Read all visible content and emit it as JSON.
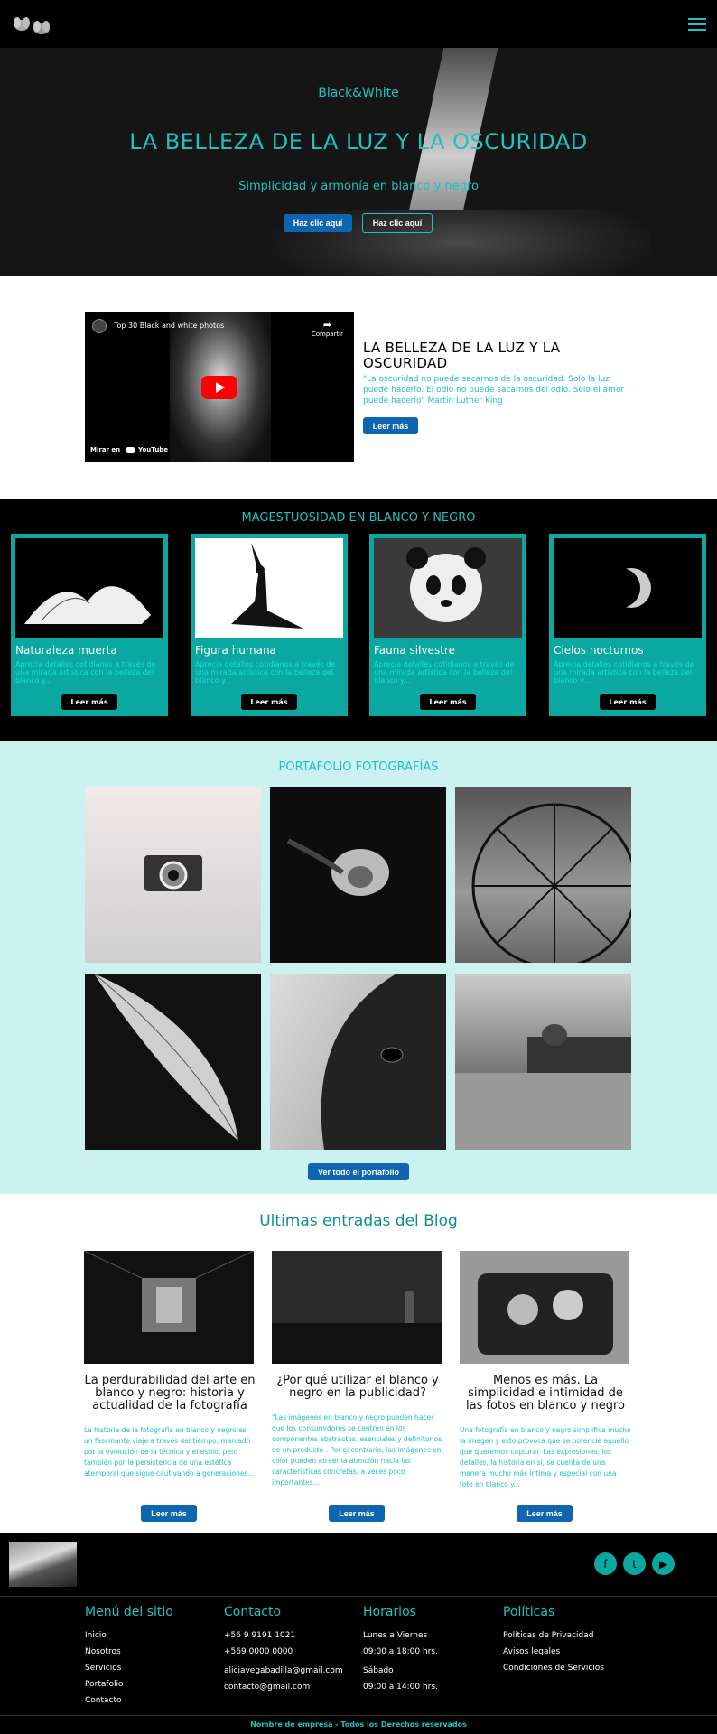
{
  "hero": {
    "brand": "Black&White",
    "title": "LA BELLEZA DE LA LUZ Y LA OSCURIDAD",
    "subtitle": "Simplicidad y armonía en blanco y negro",
    "btn_primary": "Haz clic aquí",
    "btn_secondary": "Haz clic aquí"
  },
  "video": {
    "title": "Top 30 Black and white photos",
    "share": "Compartir",
    "watch_on": "Mirar en",
    "platform": "YouTube"
  },
  "intro": {
    "title": "LA BELLEZA DE LA LUZ Y LA OSCURIDAD",
    "quote": "\"La oscuridad no puede sacarnos de la oscuridad. Solo la luz puede hacerlo. El odio no puede sacarnos del odio. Solo el amor puede hacerlo\" Martin Luther King",
    "button": "Leer más"
  },
  "categories": {
    "title": "MAGESTUOSIDAD EN BLANCO Y NEGRO",
    "items": [
      {
        "title": "Naturaleza muerta",
        "desc": "Aprecia detalles cotidianos a través de una mirada artística con la belleza del blanco y...",
        "button": "Leer más"
      },
      {
        "title": "Figura humana",
        "desc": "Aprecia detalles cotidianos a través de una mirada artística con la belleza del blanco y...",
        "button": "Leer más"
      },
      {
        "title": "Fauna silvestre",
        "desc": "Aprecia detalles cotidianos a través de una mirada artística con la belleza del blanco y...",
        "button": "Leer más"
      },
      {
        "title": "Cielos nocturnos",
        "desc": "Aprecia detalles cotidianos a través de una mirada artística con la belleza del blanco y...",
        "button": "Leer más"
      }
    ]
  },
  "portfolio": {
    "title": "PORTAFOLIO FOTOGRAFÍAS",
    "button": "Ver todo el portafolio"
  },
  "blog": {
    "title": "Ultimas entradas del Blog",
    "posts": [
      {
        "title": "La perdurabilidad del arte en blanco y negro: historia y actualidad de la fotografía",
        "excerpt": "La historia de la fotografía en blanco y negro es un fascinante viaje a través del tiempo, marcado por la evolución de la técnica y el estilo, pero también por la persistencia de una estética atemporal que sigue cautivando a generaciones...",
        "button": "Leer más"
      },
      {
        "title": "¿Por qué utilizar el blanco y negro en la publicidad?",
        "excerpt": "\"Las imágenes en blanco y negro pueden hacer que los consumidores se centren en los componentes abstractos, esenciales y definitorios de un producto . Por el contrario, las imágenes en color pueden atraer la atención hacia las características concretas, a veces poco importantes...",
        "button": "Leer más"
      },
      {
        "title": "Menos es más. La simplicidad e intimidad de las fotos en blanco y negro",
        "excerpt": "Una fotografía en blanco y negro simplifica mucho la imagen y esto provoca que se potencie aquello que queremos capturar. Las expresiones, los detalles, la historia en sí, se cuenta de una manera mucho más íntima y especial con una foto en blanco y...",
        "button": "Leer más"
      }
    ]
  },
  "footer": {
    "menu": {
      "title": "Menú del sitio",
      "items": [
        "Inicio",
        "Nosotros",
        "Servicios",
        "Portafolio",
        "Contacto"
      ]
    },
    "contact": {
      "title": "Contacto",
      "items": [
        "+56 9 9191 1021",
        "+569 0000 0000",
        "aliciavegabadilla@gmail.com",
        "contacto@gmail.com"
      ]
    },
    "hours": {
      "title": "Horarios",
      "items": [
        "Lunes a Viernes",
        "09:00 a 18:00 hrs.",
        "Sábado",
        "09:00 a 14:00 hrs."
      ]
    },
    "policies": {
      "title": "Políticas",
      "items": [
        "Políticas de Privacidad",
        "Avisos legales",
        "Condiciones de Servicios"
      ]
    },
    "copyright": "Nombre de empresa - Todos los Derechos reservados"
  }
}
